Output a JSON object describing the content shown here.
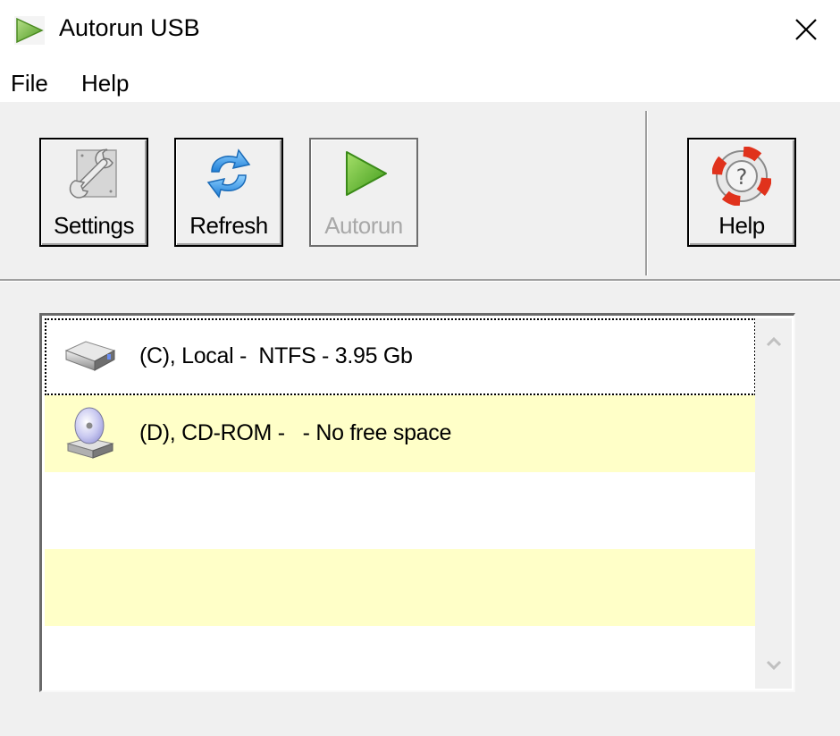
{
  "window": {
    "title": "Autorun USB",
    "app_icon": "play-triangle-icon",
    "close_icon": "close-icon"
  },
  "menu": {
    "items": [
      {
        "label": "File"
      },
      {
        "label": "Help"
      }
    ]
  },
  "toolbar": {
    "buttons": [
      {
        "label": "Settings",
        "icon": "wrench-icon",
        "enabled": true
      },
      {
        "label": "Refresh",
        "icon": "refresh-icon",
        "enabled": true
      },
      {
        "label": "Autorun",
        "icon": "play-icon",
        "enabled": false
      },
      {
        "label": "Help",
        "icon": "lifebuoy-help-icon",
        "enabled": true
      }
    ]
  },
  "drives": {
    "rows": [
      {
        "text": "(C), Local -  NTFS - 3.95 Gb",
        "icon": "hard-drive-icon",
        "focused": true
      },
      {
        "text": "(D), CD-ROM -   - No free space",
        "icon": "cd-drive-icon",
        "focused": false
      },
      {
        "text": "",
        "icon": null,
        "focused": false
      },
      {
        "text": "",
        "icon": null,
        "focused": false
      },
      {
        "text": "",
        "icon": null,
        "focused": false
      }
    ],
    "alt_row_color": "#ffffc8"
  },
  "colors": {
    "accent_green": "#5cb82e",
    "refresh_blue": "#2f9be8",
    "help_red": "#e0321c",
    "disabled_text": "#a8a8a8"
  }
}
